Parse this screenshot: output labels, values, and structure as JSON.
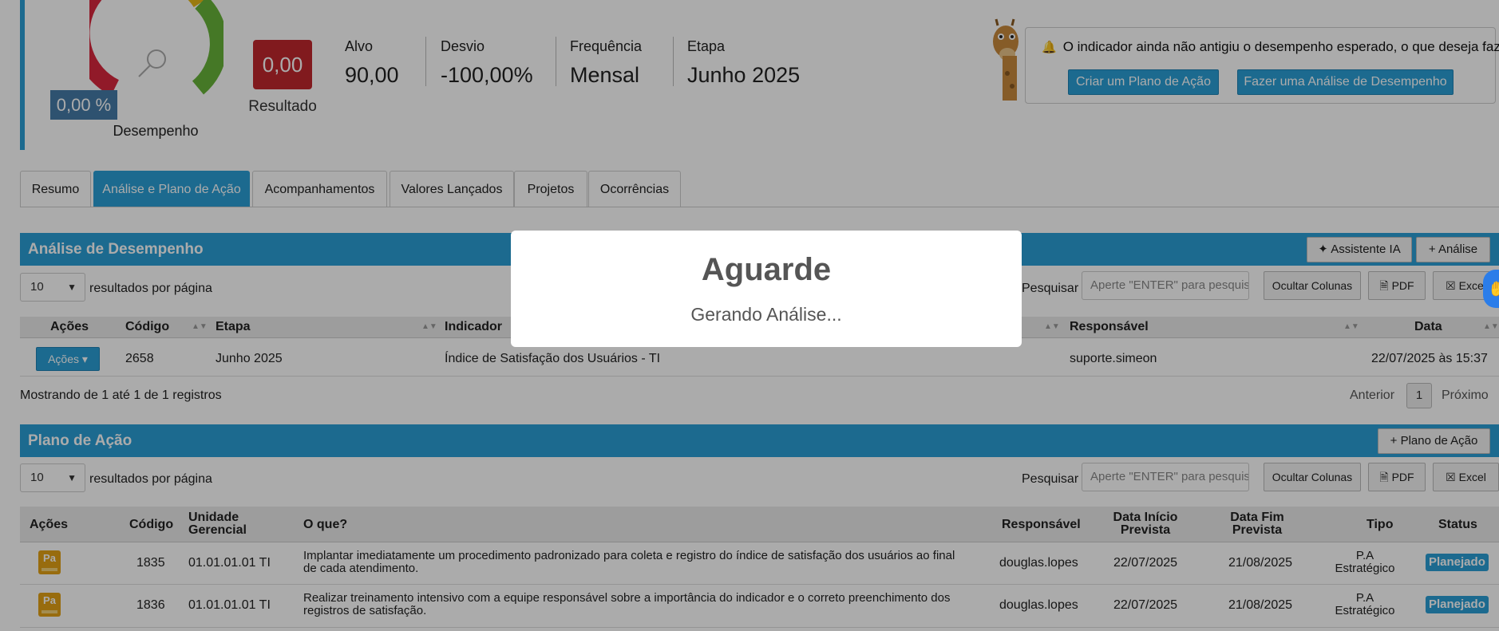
{
  "header": {
    "performance_value": "0,00 %",
    "performance_label": "Desempenho",
    "result_value": "0,00",
    "result_label": "Resultado",
    "kpis": [
      {
        "label": "Alvo",
        "value": "90,00"
      },
      {
        "label": "Desvio",
        "value": "-100,00%"
      },
      {
        "label": "Frequência",
        "value": "Mensal"
      },
      {
        "label": "Etapa",
        "value": "Junho 2025"
      }
    ],
    "alert_message": "O indicador ainda não antigiu o desempenho esperado, o que deseja fazer?",
    "create_plan_button": "Criar um Plano de Ação",
    "analysis_button": "Fazer uma Análise de Desempenho"
  },
  "tabs": [
    {
      "label": "Resumo",
      "active": false
    },
    {
      "label": "Análise e Plano de Ação",
      "active": true
    },
    {
      "label": "Acompanhamentos",
      "active": false
    },
    {
      "label": "Valores Lançados",
      "active": false
    },
    {
      "label": "Projetos",
      "active": false
    },
    {
      "label": "Ocorrências",
      "active": false
    }
  ],
  "analysis_panel": {
    "title": "Análise de Desempenho",
    "ai_button": "Assistente IA",
    "add_button": "+ Análise",
    "page_size": "10",
    "per_page_label": "resultados por página",
    "search_label": "Pesquisar",
    "search_placeholder": "Aperte \"ENTER\" para pesquisar",
    "hide_columns": "Ocultar Colunas",
    "pdf": "PDF",
    "excel": "Excel",
    "columns": [
      "Ações",
      "Código",
      "Etapa",
      "Indicador",
      "Responsável",
      "Data"
    ],
    "rows": [
      {
        "acoes": "Ações",
        "codigo": "2658",
        "etapa": "Junho 2025",
        "indicador": "Índice de Satisfação dos Usuários - TI",
        "responsavel": "suporte.simeon",
        "data": "22/07/2025 às 15:37"
      }
    ],
    "info": "Mostrando de 1 até 1 de 1 registros",
    "prev": "Anterior",
    "page": "1",
    "next": "Próximo"
  },
  "action_panel": {
    "title": "Plano de Ação",
    "add_button": "+ Plano de Ação",
    "page_size": "10",
    "per_page_label": "resultados por página",
    "search_label": "Pesquisar",
    "search_placeholder": "Aperte \"ENTER\" para pesquisar",
    "hide_columns": "Ocultar Colunas",
    "pdf": "PDF",
    "excel": "Excel",
    "columns": {
      "acoes": "Ações",
      "codigo": "Código",
      "unidade": "Unidade Gerencial",
      "oque": "O que?",
      "responsavel": "Responsável",
      "inicio": "Data Início Prevista",
      "fim": "Data Fim Prevista",
      "tipo": "Tipo",
      "status": "Status"
    },
    "rows": [
      {
        "icon": "Pa",
        "codigo": "1835",
        "unidade": "01.01.01.01 TI",
        "oque": "Implantar imediatamente um procedimento padronizado para coleta e registro do índice de satisfação dos usuários ao final de cada atendimento.",
        "responsavel": "douglas.lopes",
        "inicio": "22/07/2025",
        "fim": "21/08/2025",
        "tipo": "P.A Estratégico",
        "status": "Planejado"
      },
      {
        "icon": "Pa",
        "codigo": "1836",
        "unidade": "01.01.01.01 TI",
        "oque": "Realizar treinamento intensivo com a equipe responsável sobre a importância do indicador e o correto preenchimento dos registros de satisfação.",
        "responsavel": "douglas.lopes",
        "inicio": "22/07/2025",
        "fim": "21/08/2025",
        "tipo": "P.A Estratégico",
        "status": "Planejado"
      }
    ]
  },
  "modal": {
    "title": "Aguarde",
    "message": "Gerando Análise..."
  },
  "colors": {
    "accent": "#2b9fd6",
    "result_bad": "#c1282e",
    "status": "#2b9fd6"
  }
}
